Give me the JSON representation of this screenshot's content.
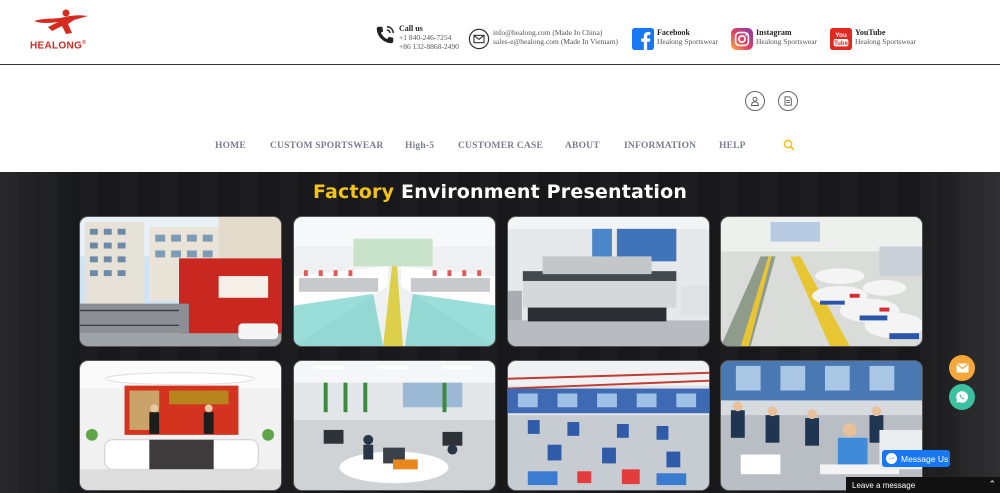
{
  "brand": {
    "name": "HEALONG",
    "trademark": "®",
    "color": "#d42a1f"
  },
  "contacts": [
    {
      "icon": "phone-icon",
      "title": "Call us",
      "line1": "+1 840-246-7254",
      "line2": "+86 132-8868-2490"
    },
    {
      "icon": "mail-icon",
      "title": "",
      "line1": "info@healong.com (Made In China)",
      "line2": "sales-e@healong.com (Made In Vietnam)"
    },
    {
      "icon": "facebook-icon",
      "title": "Facebook",
      "line1": "Healong Sportswear",
      "line2": ""
    },
    {
      "icon": "instagram-icon",
      "title": "Instagram",
      "line1": "Healong Sportswear",
      "line2": ""
    },
    {
      "icon": "youtube-icon",
      "title": "YouTube",
      "line1": "Healong Sportswear",
      "line2": ""
    }
  ],
  "header_buttons": [
    {
      "icon": "user-icon"
    },
    {
      "icon": "document-icon"
    }
  ],
  "nav": {
    "items": [
      "HOME",
      "CUSTOM SPORTSWEAR",
      "High-5",
      "CUSTOMER CASE",
      "ABOUT",
      "INFORMATION",
      "HELP"
    ],
    "search_icon": "search-icon",
    "search_color": "#f5c313"
  },
  "hero": {
    "title_accent": "Factory",
    "title_rest": "Environment Presentation",
    "accent_color": "#f5c313",
    "photos": [
      "factory-building-photo",
      "embroidery-machines-photo",
      "printing-machines-photo",
      "warehouse-photo",
      "reception-desk-photo",
      "design-office-photo",
      "production-floor-photo",
      "sewing-line-photo"
    ]
  },
  "widgets": {
    "email_button_color": "#f4a83a",
    "whatsapp_button_color": "#3cc1a0",
    "messenger_label": "Message Us",
    "leave_message_label": "Leave a message"
  }
}
